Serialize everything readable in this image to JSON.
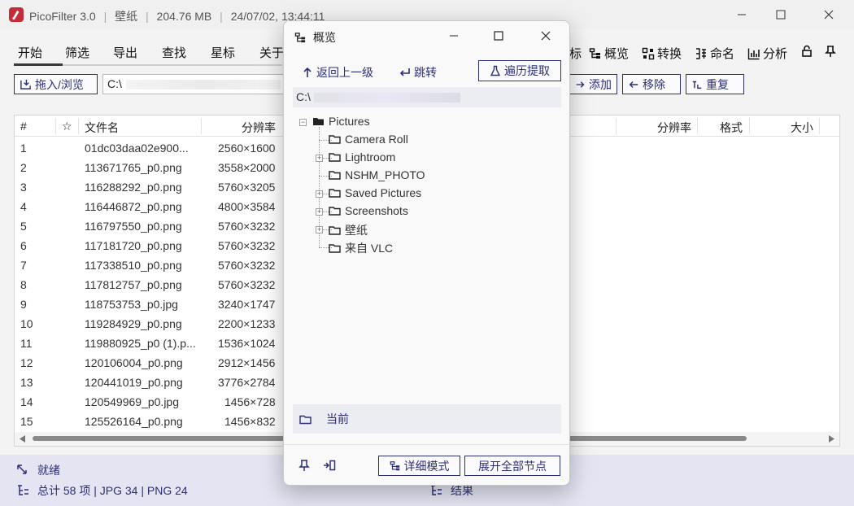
{
  "titlebar": {
    "app_name": "PicoFilter 3.0",
    "folder": "壁纸",
    "size": "204.76 MB",
    "timestamp": "24/07/02, 13:44:11",
    "sep": "|"
  },
  "tabs": [
    "开始",
    "筛选",
    "导出",
    "查找",
    "星标",
    "关于"
  ],
  "ribbon_tools": {
    "partial": "标",
    "overview": "概览",
    "convert": "转换",
    "rename": "命名",
    "analyze": "分析"
  },
  "toolbar": {
    "import_browse": "拖入/浏览",
    "path_value": "C:\\",
    "add": "添加",
    "remove": "移除",
    "repeat": "重复"
  },
  "table": {
    "headers": {
      "index": "#",
      "star": "☆",
      "filename": "文件名",
      "resolution": "分辨率",
      "resolution2": "分辨率",
      "format": "格式",
      "size": "大小"
    },
    "rows": [
      {
        "n": "1",
        "name": "01dc03daa02e900...",
        "res": "2560×1600"
      },
      {
        "n": "2",
        "name": "113671765_p0.png",
        "res": "3558×2000"
      },
      {
        "n": "3",
        "name": "116288292_p0.png",
        "res": "5760×3205"
      },
      {
        "n": "4",
        "name": "116446872_p0.png",
        "res": "4800×3584"
      },
      {
        "n": "5",
        "name": "116797550_p0.png",
        "res": "5760×3232"
      },
      {
        "n": "6",
        "name": "117181720_p0.png",
        "res": "5760×3232"
      },
      {
        "n": "7",
        "name": "117338510_p0.png",
        "res": "5760×3232"
      },
      {
        "n": "8",
        "name": "117812757_p0.png",
        "res": "5760×3232"
      },
      {
        "n": "9",
        "name": "118753753_p0.jpg",
        "res": "3240×1747"
      },
      {
        "n": "10",
        "name": "119284929_p0.png",
        "res": "2200×1233"
      },
      {
        "n": "11",
        "name": "119880925_p0 (1).p...",
        "res": "1536×1024"
      },
      {
        "n": "12",
        "name": "120106004_p0.png",
        "res": "2912×1456"
      },
      {
        "n": "13",
        "name": "120441019_p0.png",
        "res": "3776×2784"
      },
      {
        "n": "14",
        "name": "120549969_p0.jpg",
        "res": "1456×728"
      },
      {
        "n": "15",
        "name": "125526164_p0.png",
        "res": "1456×832"
      }
    ]
  },
  "status": {
    "ready": "就绪",
    "summary": "总计 58 项 | JPG 34 | PNG 24",
    "result": "结果"
  },
  "dialog": {
    "title": "概览",
    "back": "返回上一级",
    "jump": "跳转",
    "traverse": "遍历提取",
    "path": "C:\\",
    "tree": {
      "root": "Pictures",
      "children": [
        "Camera Roll",
        "Lightroom",
        "NSHM_PHOTO",
        "Saved Pictures",
        "Screenshots",
        "壁纸",
        "来自 VLC"
      ]
    },
    "current": "当前",
    "detail_mode": "详细模式",
    "expand_all": "展开全部节点"
  },
  "colors": {
    "accent": "#2b2f77",
    "app_icon": "#c42b3b",
    "status_bg": "#e4e4f2"
  }
}
